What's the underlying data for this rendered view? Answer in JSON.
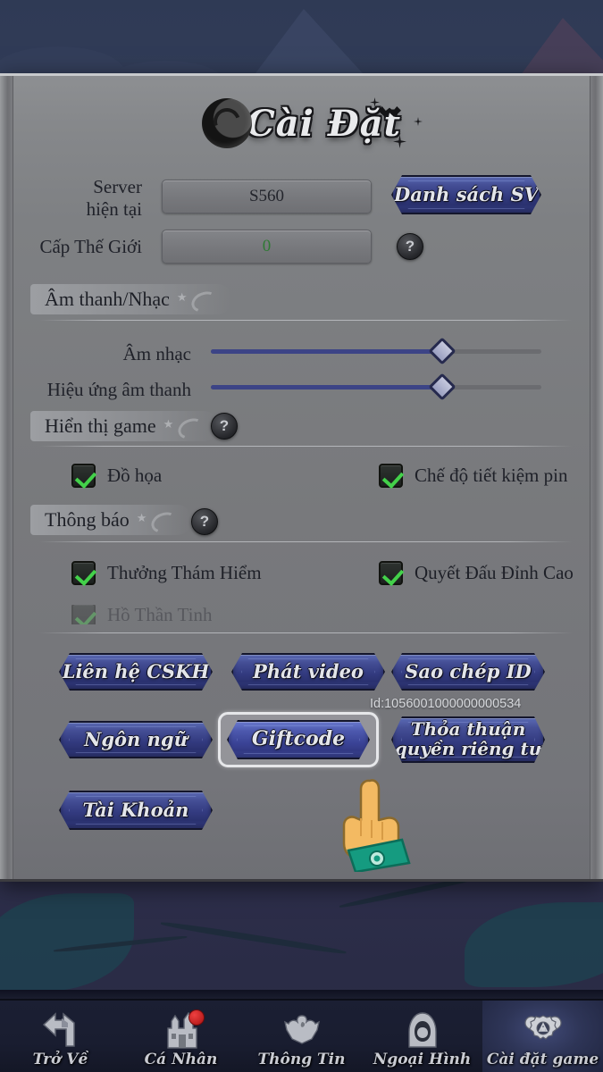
{
  "panel": {
    "title": "Cài Đặt",
    "server": {
      "label_line1": "Server",
      "label_line2": "hiện tại",
      "value": "S560",
      "server_list_button": "Danh sách SV"
    },
    "world_level": {
      "label": "Cấp Thế Giới",
      "value": "0",
      "help_icon": "question-mark-icon"
    },
    "sections": [
      {
        "id": "audio",
        "title": "Âm thanh/Nhạc",
        "has_help": false,
        "sliders": [
          {
            "label": "Âm nhạc",
            "value": 70
          },
          {
            "label": "Hiệu ứng âm thanh",
            "value": 70
          }
        ]
      },
      {
        "id": "display",
        "title": "Hiển thị game",
        "has_help": true,
        "checkboxes": [
          {
            "label": "Đồ họa",
            "checked": true
          },
          {
            "label": "Chế độ tiết kiệm pin",
            "checked": true
          }
        ]
      },
      {
        "id": "notifications",
        "title": "Thông báo",
        "has_help": true,
        "checkboxes": [
          {
            "label": "Thưởng Thám Hiểm",
            "checked": true
          },
          {
            "label": "Quyết Đấu Đỉnh Cao",
            "checked": true
          },
          {
            "label": "Hồ Thần Tinh",
            "checked": true,
            "clipped": true
          }
        ]
      }
    ],
    "actions": {
      "row1": [
        "Liên hệ CSKH",
        "Phát video",
        "Sao chép ID"
      ],
      "row2": [
        "Ngôn ngữ",
        "Giftcode",
        "Thỏa thuận\nquyền riêng tư"
      ],
      "row3": [
        "Tài Khoản"
      ],
      "focused_button": "Giftcode",
      "account_id": "Id:1056001000000000534"
    }
  },
  "cursor": {
    "type": "pointing-hand-cursor",
    "skin_color": "#f3ba62",
    "cuff_color": "#159b80"
  },
  "nav": {
    "items": [
      {
        "label": "Trở Về",
        "icon": "back-arrow-icon",
        "active": false,
        "badge": false
      },
      {
        "label": "Cá Nhân",
        "icon": "castle-icon",
        "active": false,
        "badge": true
      },
      {
        "label": "Thông Tin",
        "icon": "wing-crest-icon",
        "active": false,
        "badge": false
      },
      {
        "label": "Ngoại Hình",
        "icon": "hooded-figure-icon",
        "active": false,
        "badge": false
      },
      {
        "label": "Cài đặt game",
        "icon": "gear-icon",
        "active": true,
        "badge": false
      }
    ]
  },
  "colors": {
    "button_blue": "#3b4490",
    "check_green": "#43d14a",
    "value_green": "#2f7a34",
    "panel_gray": "#7a7b7f",
    "badge_red": "#d42a2a"
  }
}
